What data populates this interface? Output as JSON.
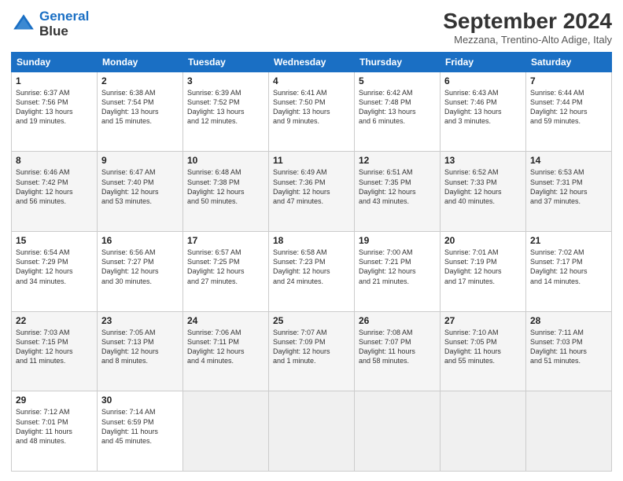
{
  "logo": {
    "line1": "General",
    "line2": "Blue"
  },
  "title": "September 2024",
  "location": "Mezzana, Trentino-Alto Adige, Italy",
  "days": [
    "Sunday",
    "Monday",
    "Tuesday",
    "Wednesday",
    "Thursday",
    "Friday",
    "Saturday"
  ],
  "weeks": [
    [
      {
        "num": "1",
        "info": "Sunrise: 6:37 AM\nSunset: 7:56 PM\nDaylight: 13 hours\nand 19 minutes."
      },
      {
        "num": "2",
        "info": "Sunrise: 6:38 AM\nSunset: 7:54 PM\nDaylight: 13 hours\nand 15 minutes."
      },
      {
        "num": "3",
        "info": "Sunrise: 6:39 AM\nSunset: 7:52 PM\nDaylight: 13 hours\nand 12 minutes."
      },
      {
        "num": "4",
        "info": "Sunrise: 6:41 AM\nSunset: 7:50 PM\nDaylight: 13 hours\nand 9 minutes."
      },
      {
        "num": "5",
        "info": "Sunrise: 6:42 AM\nSunset: 7:48 PM\nDaylight: 13 hours\nand 6 minutes."
      },
      {
        "num": "6",
        "info": "Sunrise: 6:43 AM\nSunset: 7:46 PM\nDaylight: 13 hours\nand 3 minutes."
      },
      {
        "num": "7",
        "info": "Sunrise: 6:44 AM\nSunset: 7:44 PM\nDaylight: 12 hours\nand 59 minutes."
      }
    ],
    [
      {
        "num": "8",
        "info": "Sunrise: 6:46 AM\nSunset: 7:42 PM\nDaylight: 12 hours\nand 56 minutes."
      },
      {
        "num": "9",
        "info": "Sunrise: 6:47 AM\nSunset: 7:40 PM\nDaylight: 12 hours\nand 53 minutes."
      },
      {
        "num": "10",
        "info": "Sunrise: 6:48 AM\nSunset: 7:38 PM\nDaylight: 12 hours\nand 50 minutes."
      },
      {
        "num": "11",
        "info": "Sunrise: 6:49 AM\nSunset: 7:36 PM\nDaylight: 12 hours\nand 47 minutes."
      },
      {
        "num": "12",
        "info": "Sunrise: 6:51 AM\nSunset: 7:35 PM\nDaylight: 12 hours\nand 43 minutes."
      },
      {
        "num": "13",
        "info": "Sunrise: 6:52 AM\nSunset: 7:33 PM\nDaylight: 12 hours\nand 40 minutes."
      },
      {
        "num": "14",
        "info": "Sunrise: 6:53 AM\nSunset: 7:31 PM\nDaylight: 12 hours\nand 37 minutes."
      }
    ],
    [
      {
        "num": "15",
        "info": "Sunrise: 6:54 AM\nSunset: 7:29 PM\nDaylight: 12 hours\nand 34 minutes."
      },
      {
        "num": "16",
        "info": "Sunrise: 6:56 AM\nSunset: 7:27 PM\nDaylight: 12 hours\nand 30 minutes."
      },
      {
        "num": "17",
        "info": "Sunrise: 6:57 AM\nSunset: 7:25 PM\nDaylight: 12 hours\nand 27 minutes."
      },
      {
        "num": "18",
        "info": "Sunrise: 6:58 AM\nSunset: 7:23 PM\nDaylight: 12 hours\nand 24 minutes."
      },
      {
        "num": "19",
        "info": "Sunrise: 7:00 AM\nSunset: 7:21 PM\nDaylight: 12 hours\nand 21 minutes."
      },
      {
        "num": "20",
        "info": "Sunrise: 7:01 AM\nSunset: 7:19 PM\nDaylight: 12 hours\nand 17 minutes."
      },
      {
        "num": "21",
        "info": "Sunrise: 7:02 AM\nSunset: 7:17 PM\nDaylight: 12 hours\nand 14 minutes."
      }
    ],
    [
      {
        "num": "22",
        "info": "Sunrise: 7:03 AM\nSunset: 7:15 PM\nDaylight: 12 hours\nand 11 minutes."
      },
      {
        "num": "23",
        "info": "Sunrise: 7:05 AM\nSunset: 7:13 PM\nDaylight: 12 hours\nand 8 minutes."
      },
      {
        "num": "24",
        "info": "Sunrise: 7:06 AM\nSunset: 7:11 PM\nDaylight: 12 hours\nand 4 minutes."
      },
      {
        "num": "25",
        "info": "Sunrise: 7:07 AM\nSunset: 7:09 PM\nDaylight: 12 hours\nand 1 minute."
      },
      {
        "num": "26",
        "info": "Sunrise: 7:08 AM\nSunset: 7:07 PM\nDaylight: 11 hours\nand 58 minutes."
      },
      {
        "num": "27",
        "info": "Sunrise: 7:10 AM\nSunset: 7:05 PM\nDaylight: 11 hours\nand 55 minutes."
      },
      {
        "num": "28",
        "info": "Sunrise: 7:11 AM\nSunset: 7:03 PM\nDaylight: 11 hours\nand 51 minutes."
      }
    ],
    [
      {
        "num": "29",
        "info": "Sunrise: 7:12 AM\nSunset: 7:01 PM\nDaylight: 11 hours\nand 48 minutes."
      },
      {
        "num": "30",
        "info": "Sunrise: 7:14 AM\nSunset: 6:59 PM\nDaylight: 11 hours\nand 45 minutes."
      },
      null,
      null,
      null,
      null,
      null
    ]
  ]
}
